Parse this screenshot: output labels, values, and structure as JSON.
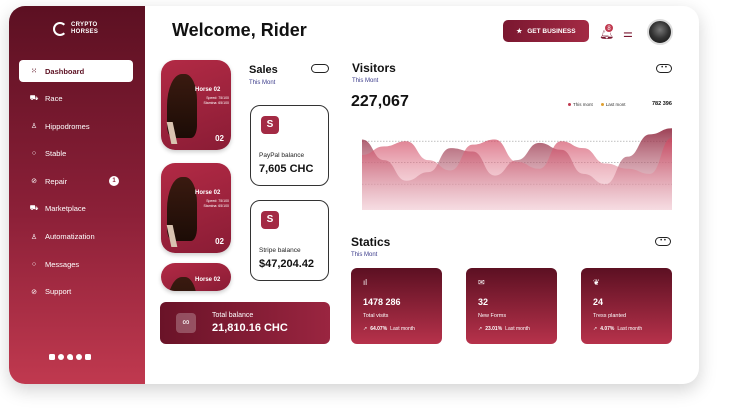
{
  "brand": {
    "line1": "CRYPTO",
    "line2": "HORSES"
  },
  "sidebar": {
    "items": [
      {
        "label": "Dashboard",
        "icon": "dashboard-icon",
        "glyph": "⁙",
        "active": true
      },
      {
        "label": "Race",
        "icon": "cart-icon",
        "glyph": "⛟"
      },
      {
        "label": "Hippodromes",
        "icon": "user-icon",
        "glyph": "♙"
      },
      {
        "label": "Stable",
        "icon": "chat-icon",
        "glyph": "○"
      },
      {
        "label": "Repair",
        "icon": "clip-icon",
        "glyph": "⊘",
        "badge": "1"
      },
      {
        "label": "Marketplace",
        "icon": "cart-icon",
        "glyph": "⛟"
      },
      {
        "label": "Automatization",
        "icon": "user-icon",
        "glyph": "♙"
      },
      {
        "label": "Messages",
        "icon": "chat-icon",
        "glyph": "○"
      },
      {
        "label": "Support",
        "icon": "clip-icon",
        "glyph": "⊘"
      }
    ]
  },
  "header": {
    "welcome_prefix": "Welcome,",
    "welcome_name": "Rider",
    "business_button": "GET BUSINESS",
    "notification_count": "8"
  },
  "horses": [
    {
      "name": "Horse 02",
      "speed": "Speed: 75/100",
      "stamina": "Stamina: 65/100",
      "number": "02"
    },
    {
      "name": "Horse 02",
      "speed": "Speed: 75/100",
      "stamina": "Stamina: 65/100",
      "number": "02"
    },
    {
      "name": "Horse 02"
    }
  ],
  "sales": {
    "title": "Sales",
    "subtitle": "This Mont",
    "paypal": {
      "icon": "S",
      "label": "PayPal balance",
      "value": "7,605 CHC"
    },
    "stripe": {
      "icon": "S",
      "label": "Stripe balance",
      "value": "$47,204.42"
    },
    "total": {
      "label": "Total balance",
      "value": "21,810.16 CHC"
    }
  },
  "visitors": {
    "title": "Visitors",
    "subtitle": "This Mont",
    "total": "227,067",
    "legend_this": "This mont",
    "legend_last": "Last mont",
    "legend_value": "782 396"
  },
  "chart_data": {
    "type": "area",
    "series": [
      {
        "values": [
          82,
          58,
          34,
          44,
          72,
          68,
          40,
          58,
          78,
          70,
          42,
          30,
          62,
          88,
          95
        ]
      },
      {
        "values": [
          64,
          74,
          80,
          58,
          46,
          76,
          82,
          56,
          48,
          80,
          72,
          54,
          48,
          42,
          84
        ]
      }
    ],
    "ylim": [
      0,
      100
    ],
    "grid": true
  },
  "statics": {
    "title": "Statics",
    "subtitle": "This Mont",
    "cards": [
      {
        "icon": "bar-chart-icon",
        "glyph": "ıl",
        "value": "1478 286",
        "label": "Total visits",
        "pct": "64.07%",
        "period": "Last month"
      },
      {
        "icon": "mail-icon",
        "glyph": "✉",
        "value": "32",
        "label": "New Forms",
        "pct": "23.01%",
        "period": "Last month"
      },
      {
        "icon": "leaf-icon",
        "glyph": "❦",
        "value": "24",
        "label": "Tress planted",
        "pct": "4.07%",
        "period": "Last month"
      }
    ]
  },
  "colors": {
    "primary": "#8c2038",
    "accent": "#c0394f",
    "dark": "#5c1022"
  }
}
